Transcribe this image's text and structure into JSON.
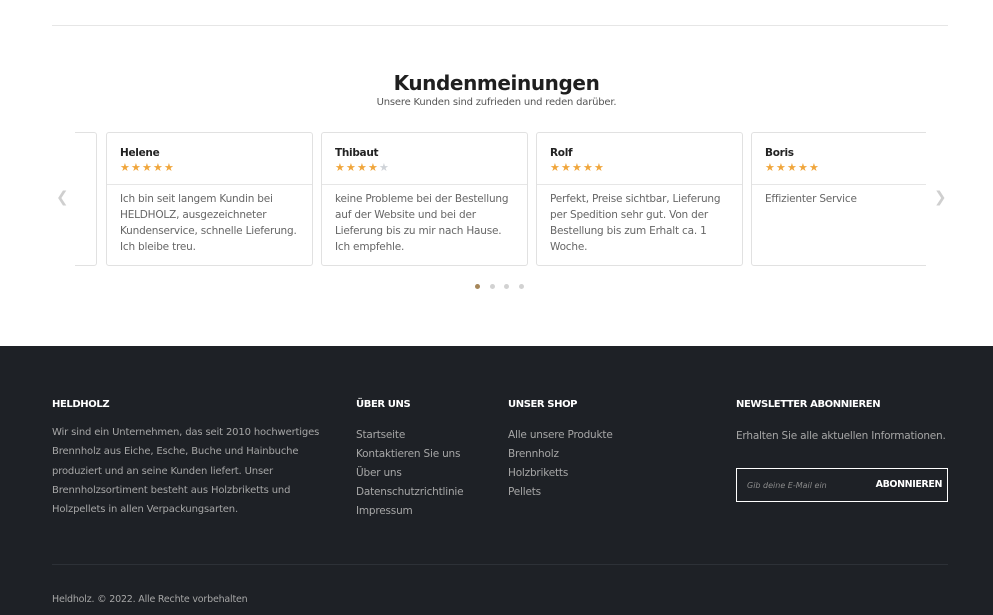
{
  "reviews": {
    "title": "Kundenmeinungen",
    "subtitle": "Unsere Kunden sind zufrieden und reden darüber.",
    "star_color": "#f0a63c",
    "star_empty_color": "#cfd3d8",
    "prev_icon": "chevron-left-icon",
    "next_icon": "chevron-right-icon",
    "items": [
      {
        "name": "Helene",
        "rating": 5,
        "text": "Ich bin seit langem Kundin bei HELDHOLZ, ausgezeichneter Kundenservice, schnelle Lieferung. Ich bleibe treu."
      },
      {
        "name": "Thibaut",
        "rating": 4,
        "text": "keine Probleme bei der Bestellung auf der Website und bei der Lieferung bis zu mir nach Hause. Ich empfehle."
      },
      {
        "name": "Rolf",
        "rating": 5,
        "text": "Perfekt, Preise sichtbar, Lieferung per Spedition sehr gut. Von der Bestellung bis zum Erhalt ca. 1 Woche."
      },
      {
        "name": "Boris",
        "rating": 5,
        "text": "Effizienter Service"
      }
    ],
    "pagination": {
      "count": 4,
      "active": 0,
      "active_color": "#a6875a"
    }
  },
  "footer": {
    "background": "#1e2126",
    "about": {
      "heading": "HELDHOLZ",
      "text": "Wir sind ein Unternehmen, das seit 2010 hochwertiges Brennholz aus Eiche, Esche, Buche und Hainbuche produziert und an seine Kunden liefert. Unser Brennholzsortiment besteht aus Holzbriketts und Holzpellets in allen Verpackungsarten."
    },
    "ueber_uns": {
      "heading": "ÜBER UNS",
      "links": [
        "Startseite",
        "Kontaktieren Sie uns",
        "Über uns",
        "Datenschutzrichtlinie",
        "Impressum"
      ]
    },
    "shop": {
      "heading": "UNSER SHOP",
      "links": [
        "Alle unsere Produkte",
        "Brennholz",
        "Holzbriketts",
        "Pellets"
      ]
    },
    "newsletter": {
      "heading": "NEWSLETTER ABONNIEREN",
      "text": "Erhalten Sie alle aktuellen Informationen.",
      "placeholder": "Gib deine E-Mail ein",
      "button": "ABONNIEREN"
    },
    "copyright": "Heldholz. © 2022. Alle Rechte vorbehalten"
  }
}
